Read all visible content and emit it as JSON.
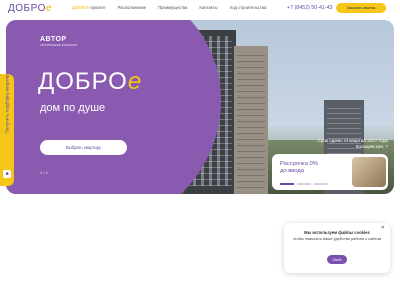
{
  "header": {
    "logo_main": "ДОБРО",
    "logo_accent": "е",
    "nav": [
      {
        "brand": "ДОБРОе",
        "text": " проекте"
      },
      {
        "text": "Расположение"
      },
      {
        "text": "Преимущества"
      },
      {
        "text": "Контакты"
      },
      {
        "text": "Ход строительства"
      }
    ],
    "phone": "+7 (8452) 50-41-43",
    "call_label": "Заказать звонок"
  },
  "hero": {
    "developer": "АВТОР",
    "developer_sub": "СТРОИТЕЛЬНАЯ КОМПАНИЯ",
    "title_main": "ДОБРО",
    "title_accent": "е",
    "subtitle": "дом по душе",
    "choose_label": "Выбрать квартиру",
    "slider_counter": "1 / 4",
    "deadline_line1": "Срок сдачи: III квартал 2027 года",
    "deadline_line2": "Кольцевская, 7",
    "promo_text": "Рассрочка 0% до ввода"
  },
  "side_tab": {
    "label": "Получить подборку квартир"
  },
  "cookie": {
    "title": "Мы используем файлы cookies",
    "text": "чтобы повысить ваше удобство работы с сайтом",
    "ok_label": "Окей"
  },
  "colors": {
    "brand_purple": "#8a5ab0",
    "accent_yellow": "#f5c518"
  }
}
